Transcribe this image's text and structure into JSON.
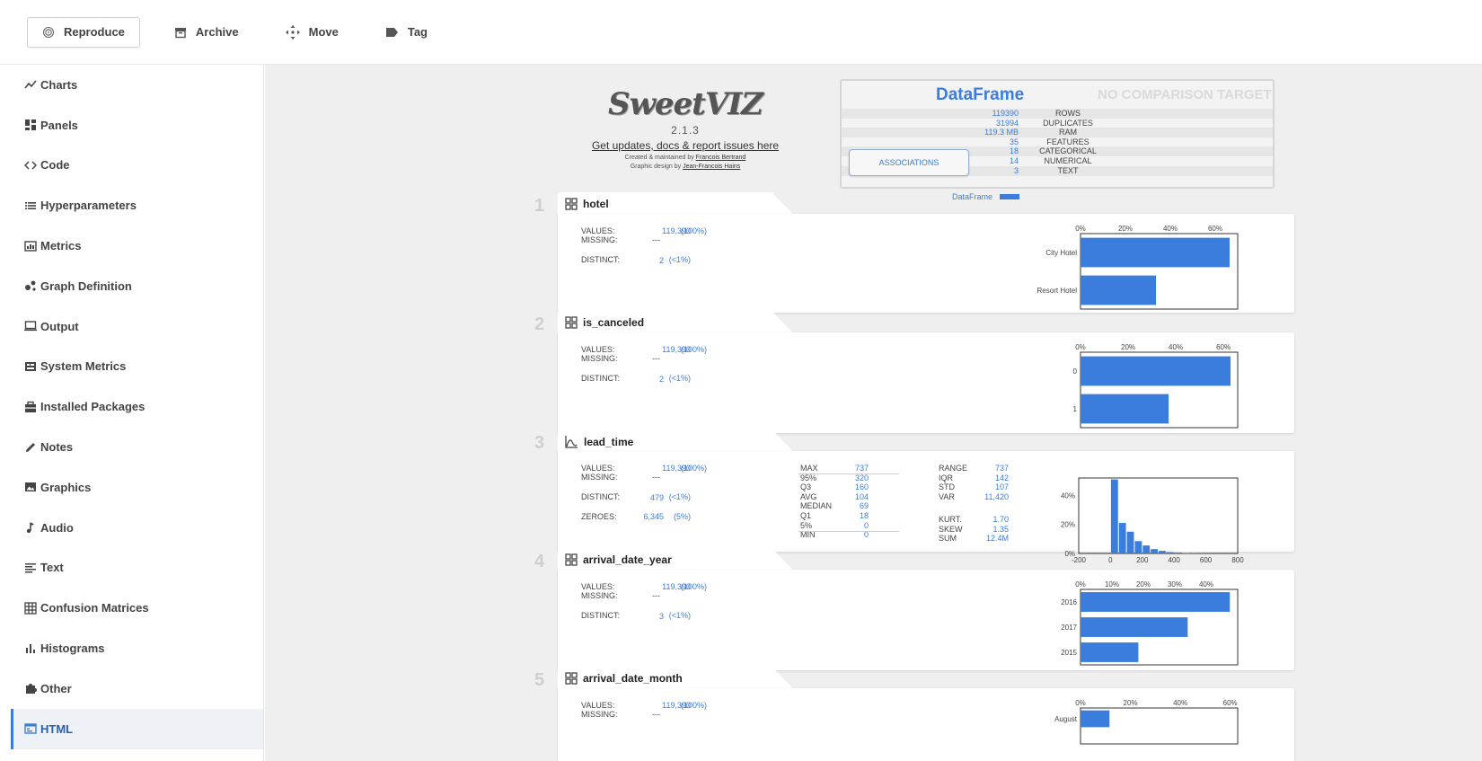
{
  "toolbar": {
    "reproduce": "Reproduce",
    "archive": "Archive",
    "move": "Move",
    "tag": "Tag"
  },
  "sidebar": {
    "items": [
      {
        "label": "Charts",
        "icon": "line-chart-icon"
      },
      {
        "label": "Panels",
        "icon": "panels-icon"
      },
      {
        "label": "Code",
        "icon": "code-icon"
      },
      {
        "label": "Hyperparameters",
        "icon": "list-icon"
      },
      {
        "label": "Metrics",
        "icon": "metrics-icon"
      },
      {
        "label": "Graph Definition",
        "icon": "graph-icon"
      },
      {
        "label": "Output",
        "icon": "monitor-icon"
      },
      {
        "label": "System Metrics",
        "icon": "system-icon"
      },
      {
        "label": "Installed Packages",
        "icon": "package-icon"
      },
      {
        "label": "Notes",
        "icon": "pencil-icon"
      },
      {
        "label": "Graphics",
        "icon": "image-icon"
      },
      {
        "label": "Audio",
        "icon": "music-note-icon"
      },
      {
        "label": "Text",
        "icon": "text-icon"
      },
      {
        "label": "Confusion Matrices",
        "icon": "grid-icon"
      },
      {
        "label": "Histograms",
        "icon": "histogram-icon"
      },
      {
        "label": "Other",
        "icon": "puzzle-icon"
      },
      {
        "label": "HTML",
        "icon": "html-icon"
      }
    ],
    "active": "HTML"
  },
  "report": {
    "logo": {
      "name": "SweetVIZ",
      "version": "2.1.3",
      "link": "Get updates, docs & report issues here",
      "created_prefix": "Created & maintained by ",
      "created_by": "Francois Bertrand",
      "design_prefix": "Graphic design by ",
      "design_by": "Jean-Francois Hains"
    },
    "dataframe": {
      "title": "DataFrame",
      "no_target": "NO COMPARISON TARGET",
      "associations": "ASSOCIATIONS",
      "legend": "DataFrame",
      "rows": [
        {
          "value": "119390",
          "label": "ROWS"
        },
        {
          "value": "31994",
          "label": "DUPLICATES"
        },
        {
          "value": "119.3 MB",
          "label": "RAM"
        },
        {
          "value": "35",
          "label": "FEATURES"
        },
        {
          "value": "18",
          "label": "CATEGORICAL"
        },
        {
          "value": "14",
          "label": "NUMERICAL"
        },
        {
          "value": "3",
          "label": "TEXT"
        }
      ]
    },
    "labels": {
      "values": "VALUES:",
      "missing": "MISSING:",
      "distinct": "DISTINCT:",
      "zeroes": "ZEROES:"
    },
    "features": [
      {
        "num": "1",
        "name": "hotel",
        "type": "categorical",
        "values": "119,390",
        "values_pct": "(100%)",
        "missing": "---",
        "distinct": "2",
        "distinct_pct": "(<1%)"
      },
      {
        "num": "2",
        "name": "is_canceled",
        "type": "categorical",
        "values": "119,390",
        "values_pct": "(100%)",
        "missing": "---",
        "distinct": "2",
        "distinct_pct": "(<1%)"
      },
      {
        "num": "3",
        "name": "lead_time",
        "type": "numerical",
        "values": "119,390",
        "values_pct": "(100%)",
        "missing": "---",
        "distinct": "479",
        "distinct_pct": "(<1%)",
        "zeroes": "6,345",
        "zeroes_pct": "(5%)",
        "quantiles": [
          {
            "l": "MAX",
            "v": "737"
          },
          {
            "l": "95%",
            "v": "320"
          },
          {
            "l": "Q3",
            "v": "160"
          },
          {
            "l": "AVG",
            "v": "104"
          },
          {
            "l": "MEDIAN",
            "v": "69"
          },
          {
            "l": "Q1",
            "v": "18"
          },
          {
            "l": "5%",
            "v": "0"
          },
          {
            "l": "MIN",
            "v": "0"
          }
        ],
        "moments": [
          {
            "l": "RANGE",
            "v": "737"
          },
          {
            "l": "IQR",
            "v": "142"
          },
          {
            "l": "STD",
            "v": "107"
          },
          {
            "l": "VAR",
            "v": "11,420"
          },
          {
            "l": "KURT.",
            "v": "1.70"
          },
          {
            "l": "SKEW",
            "v": "1.35"
          },
          {
            "l": "SUM",
            "v": "12.4M"
          }
        ]
      },
      {
        "num": "4",
        "name": "arrival_date_year",
        "type": "categorical",
        "values": "119,390",
        "values_pct": "(100%)",
        "missing": "---",
        "distinct": "3",
        "distinct_pct": "(<1%)"
      },
      {
        "num": "5",
        "name": "arrival_date_month",
        "type": "categorical",
        "values": "119,390",
        "values_pct": "(100%)",
        "missing": "---"
      }
    ]
  },
  "chart_data": [
    {
      "type": "bar",
      "title": "hotel",
      "orientation": "horizontal",
      "categories": [
        "City Hotel",
        "Resort Hotel"
      ],
      "values": [
        66.4,
        33.6
      ],
      "xlim": [
        0,
        70
      ],
      "xticks": [
        "0%",
        "20%",
        "40%",
        "60%"
      ],
      "tick_values": [
        0,
        20,
        40,
        60
      ],
      "color": "#3b7ddd"
    },
    {
      "type": "bar",
      "title": "is_canceled",
      "orientation": "horizontal",
      "categories": [
        "0",
        "1"
      ],
      "values": [
        63.0,
        37.0
      ],
      "xlim": [
        0,
        66
      ],
      "xticks": [
        "0%",
        "20%",
        "40%",
        "60%"
      ],
      "tick_values": [
        0,
        20,
        40,
        60
      ],
      "color": "#3b7ddd"
    },
    {
      "type": "bar",
      "title": "lead_time",
      "orientation": "vertical",
      "histogram": true,
      "bins": [
        0,
        50,
        100,
        150,
        200,
        250,
        300,
        350,
        400,
        450,
        500,
        550,
        600,
        650,
        700,
        750
      ],
      "values": [
        51,
        21,
        15,
        8.5,
        5.5,
        3,
        1.8,
        0.9,
        0.6,
        0.3,
        0.2,
        0.1,
        0.05,
        0.03,
        0.02
      ],
      "xlim": [
        -200,
        800
      ],
      "ylim": [
        0,
        52
      ],
      "xticks": [
        "-200",
        "0",
        "200",
        "400",
        "600",
        "800"
      ],
      "xtick_values": [
        -200,
        0,
        200,
        400,
        600,
        800
      ],
      "yticks": [
        "0%",
        "20%",
        "40%"
      ],
      "ytick_values": [
        0,
        20,
        40
      ],
      "color": "#3b7ddd"
    },
    {
      "type": "bar",
      "title": "arrival_date_year",
      "orientation": "horizontal",
      "categories": [
        "2016",
        "2017",
        "2015"
      ],
      "values": [
        47.5,
        34.1,
        18.4
      ],
      "xlim": [
        0,
        50
      ],
      "xticks": [
        "0%",
        "10%",
        "20%",
        "30%",
        "40%"
      ],
      "tick_values": [
        0,
        10,
        20,
        30,
        40
      ],
      "color": "#3b7ddd"
    },
    {
      "type": "bar",
      "title": "arrival_date_month",
      "orientation": "horizontal",
      "categories": [
        "August"
      ],
      "values": [
        11.6
      ],
      "xlim": [
        0,
        63
      ],
      "xticks": [
        "0%",
        "20%",
        "40%",
        "60%"
      ],
      "tick_values": [
        0,
        20,
        40,
        60
      ],
      "color": "#3b7ddd"
    }
  ]
}
